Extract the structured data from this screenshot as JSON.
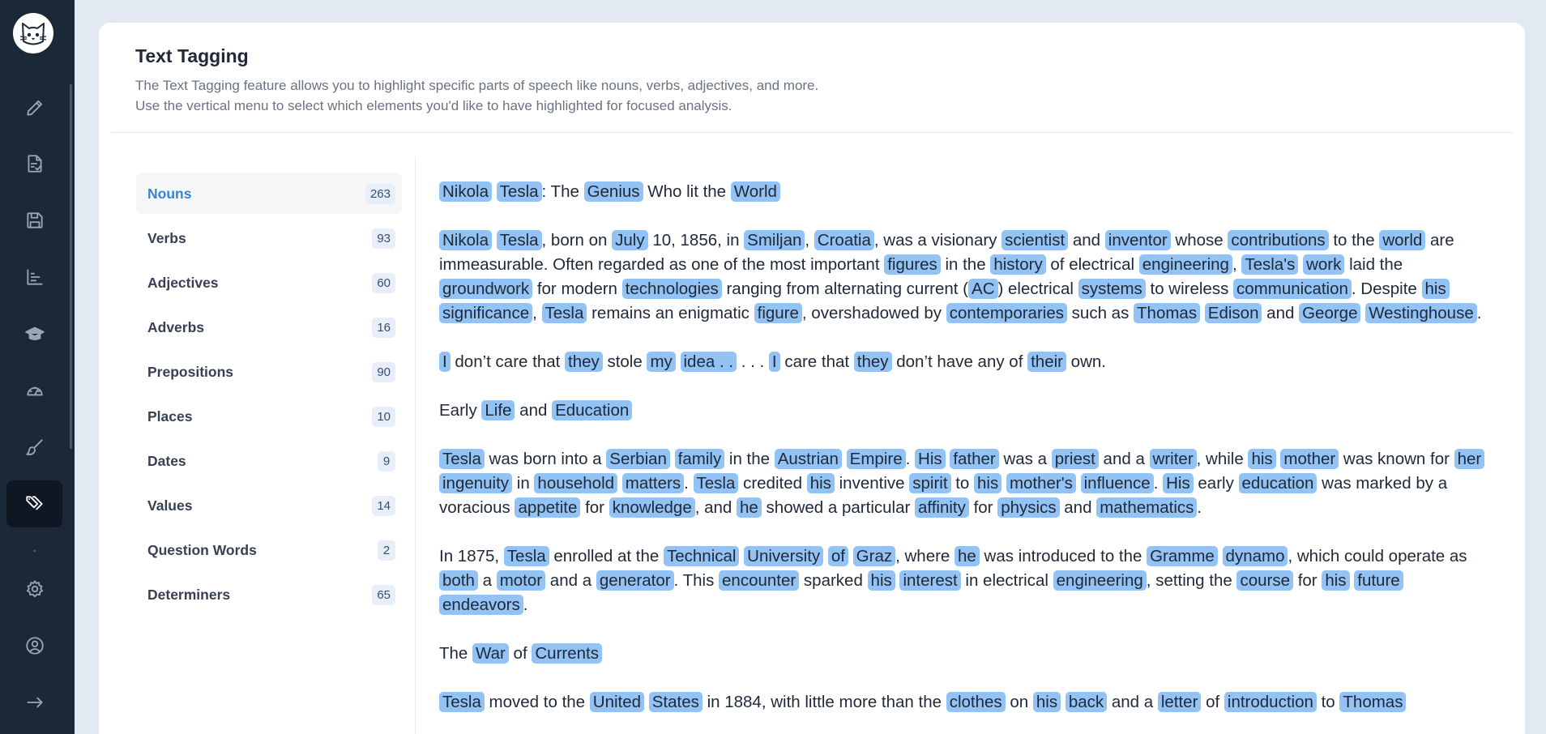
{
  "sidebar": {
    "items": [
      {
        "icon": "pencil-icon",
        "active": false
      },
      {
        "icon": "checklist-icon",
        "active": false
      },
      {
        "icon": "save-icon",
        "active": false
      },
      {
        "icon": "bar-chart-icon",
        "active": false
      },
      {
        "icon": "graduation-cap-icon",
        "active": false
      },
      {
        "icon": "gauge-icon",
        "active": false
      },
      {
        "icon": "brush-icon",
        "active": false
      },
      {
        "icon": "tags-icon",
        "active": true
      },
      {
        "icon": "gear-icon",
        "active": false
      },
      {
        "icon": "user-circle-icon",
        "active": false
      },
      {
        "icon": "arrow-right-icon",
        "active": false
      }
    ]
  },
  "header": {
    "title": "Text Tagging",
    "desc_line1": "The Text Tagging feature allows you to highlight specific parts of speech like nouns, verbs, adjectives, and more.",
    "desc_line2": "Use the vertical menu to select which elements you'd like to have highlighted for focused analysis."
  },
  "menu": [
    {
      "label": "Nouns",
      "count": "263",
      "active": true
    },
    {
      "label": "Verbs",
      "count": "93",
      "active": false
    },
    {
      "label": "Adjectives",
      "count": "60",
      "active": false
    },
    {
      "label": "Adverbs",
      "count": "16",
      "active": false
    },
    {
      "label": "Prepositions",
      "count": "90",
      "active": false
    },
    {
      "label": "Places",
      "count": "10",
      "active": false
    },
    {
      "label": "Dates",
      "count": "9",
      "active": false
    },
    {
      "label": "Values",
      "count": "14",
      "active": false
    },
    {
      "label": "Question Words",
      "count": "2",
      "active": false
    },
    {
      "label": "Determiners",
      "count": "65",
      "active": false
    }
  ],
  "colors": {
    "highlight": "#93c2f5",
    "active_menu": "#3b82d6",
    "sidebar_bg": "#1b2838"
  },
  "paragraphs": [
    [
      [
        "Nikola",
        true
      ],
      [
        " ",
        false
      ],
      [
        "Tesla",
        true
      ],
      [
        ": The ",
        false
      ],
      [
        "Genius",
        true
      ],
      [
        " Who lit the ",
        false
      ],
      [
        "World",
        true
      ]
    ],
    [
      [
        "Nikola",
        true
      ],
      [
        " ",
        false
      ],
      [
        "Tesla",
        true
      ],
      [
        ", born on ",
        false
      ],
      [
        "July",
        true
      ],
      [
        " 10, 1856, in ",
        false
      ],
      [
        "Smiljan",
        true
      ],
      [
        ", ",
        false
      ],
      [
        "Croatia",
        true
      ],
      [
        ", was a visionary ",
        false
      ],
      [
        "scientist",
        true
      ],
      [
        " and ",
        false
      ],
      [
        "inventor",
        true
      ],
      [
        " whose ",
        false
      ],
      [
        "contributions",
        true
      ],
      [
        " to the ",
        false
      ],
      [
        "world",
        true
      ],
      [
        " are immeasurable. Often regarded as one of the most important ",
        false
      ],
      [
        "figures",
        true
      ],
      [
        " in the ",
        false
      ],
      [
        "history",
        true
      ],
      [
        " of electrical ",
        false
      ],
      [
        "engineering",
        true
      ],
      [
        ", ",
        false
      ],
      [
        "Tesla's",
        true
      ],
      [
        " ",
        false
      ],
      [
        "work",
        true
      ],
      [
        " laid the ",
        false
      ],
      [
        "groundwork",
        true
      ],
      [
        " for modern ",
        false
      ],
      [
        "technologies",
        true
      ],
      [
        " ranging from alternating current (",
        false
      ],
      [
        "AC",
        true
      ],
      [
        ") electrical ",
        false
      ],
      [
        "systems",
        true
      ],
      [
        " to wireless ",
        false
      ],
      [
        "communication",
        true
      ],
      [
        ". Despite ",
        false
      ],
      [
        "his",
        true
      ],
      [
        " ",
        false
      ],
      [
        "significance",
        true
      ],
      [
        ", ",
        false
      ],
      [
        "Tesla",
        true
      ],
      [
        " remains an enigmatic ",
        false
      ],
      [
        "figure",
        true
      ],
      [
        ", overshadowed by ",
        false
      ],
      [
        "contemporaries",
        true
      ],
      [
        " such as ",
        false
      ],
      [
        "Thomas",
        true
      ],
      [
        " ",
        false
      ],
      [
        "Edison",
        true
      ],
      [
        " and ",
        false
      ],
      [
        "George",
        true
      ],
      [
        " ",
        false
      ],
      [
        "Westinghouse",
        true
      ],
      [
        ".",
        false
      ]
    ],
    [
      [
        "I",
        true
      ],
      [
        " don’t care that ",
        false
      ],
      [
        "they",
        true
      ],
      [
        " stole ",
        false
      ],
      [
        "my",
        true
      ],
      [
        " ",
        false
      ],
      [
        "idea . .",
        true
      ],
      [
        " . . . ",
        false
      ],
      [
        "I",
        true
      ],
      [
        " care that ",
        false
      ],
      [
        "they",
        true
      ],
      [
        " don’t have any of ",
        false
      ],
      [
        "their",
        true
      ],
      [
        " own.",
        false
      ]
    ],
    [
      [
        "Early ",
        false
      ],
      [
        "Life",
        true
      ],
      [
        " and ",
        false
      ],
      [
        "Education",
        true
      ]
    ],
    [
      [
        "Tesla",
        true
      ],
      [
        " was born into a ",
        false
      ],
      [
        "Serbian",
        true
      ],
      [
        " ",
        false
      ],
      [
        "family",
        true
      ],
      [
        " in the ",
        false
      ],
      [
        "Austrian",
        true
      ],
      [
        " ",
        false
      ],
      [
        "Empire",
        true
      ],
      [
        ". ",
        false
      ],
      [
        "His",
        true
      ],
      [
        " ",
        false
      ],
      [
        "father",
        true
      ],
      [
        " was a ",
        false
      ],
      [
        "priest",
        true
      ],
      [
        " and a ",
        false
      ],
      [
        "writer",
        true
      ],
      [
        ", while ",
        false
      ],
      [
        "his",
        true
      ],
      [
        " ",
        false
      ],
      [
        "mother",
        true
      ],
      [
        " was known for ",
        false
      ],
      [
        "her",
        true
      ],
      [
        " ",
        false
      ],
      [
        "ingenuity",
        true
      ],
      [
        " in ",
        false
      ],
      [
        "household",
        true
      ],
      [
        " ",
        false
      ],
      [
        "matters",
        true
      ],
      [
        ". ",
        false
      ],
      [
        "Tesla",
        true
      ],
      [
        " credited ",
        false
      ],
      [
        "his",
        true
      ],
      [
        " inventive ",
        false
      ],
      [
        "spirit",
        true
      ],
      [
        " to ",
        false
      ],
      [
        "his",
        true
      ],
      [
        " ",
        false
      ],
      [
        "mother's",
        true
      ],
      [
        " ",
        false
      ],
      [
        "influence",
        true
      ],
      [
        ". ",
        false
      ],
      [
        "His",
        true
      ],
      [
        " early ",
        false
      ],
      [
        "education",
        true
      ],
      [
        " was marked by a voracious ",
        false
      ],
      [
        "appetite",
        true
      ],
      [
        " for ",
        false
      ],
      [
        "knowledge",
        true
      ],
      [
        ", and ",
        false
      ],
      [
        "he",
        true
      ],
      [
        " showed a particular ",
        false
      ],
      [
        "affinity",
        true
      ],
      [
        " for ",
        false
      ],
      [
        "physics",
        true
      ],
      [
        " and ",
        false
      ],
      [
        "mathematics",
        true
      ],
      [
        ".",
        false
      ]
    ],
    [
      [
        "In 1875, ",
        false
      ],
      [
        "Tesla",
        true
      ],
      [
        " enrolled at the ",
        false
      ],
      [
        "Technical",
        true
      ],
      [
        " ",
        false
      ],
      [
        "University",
        true
      ],
      [
        " ",
        false
      ],
      [
        "of",
        true
      ],
      [
        " ",
        false
      ],
      [
        "Graz",
        true
      ],
      [
        ", where ",
        false
      ],
      [
        "he",
        true
      ],
      [
        " was introduced to the ",
        false
      ],
      [
        "Gramme",
        true
      ],
      [
        " ",
        false
      ],
      [
        "dynamo",
        true
      ],
      [
        ", which could operate as ",
        false
      ],
      [
        "both",
        true
      ],
      [
        " a ",
        false
      ],
      [
        "motor",
        true
      ],
      [
        " and a ",
        false
      ],
      [
        "generator",
        true
      ],
      [
        ". This ",
        false
      ],
      [
        "encounter",
        true
      ],
      [
        " sparked ",
        false
      ],
      [
        "his",
        true
      ],
      [
        " ",
        false
      ],
      [
        "interest",
        true
      ],
      [
        " in electrical ",
        false
      ],
      [
        "engineering",
        true
      ],
      [
        ", setting the ",
        false
      ],
      [
        "course",
        true
      ],
      [
        " for ",
        false
      ],
      [
        "his",
        true
      ],
      [
        " ",
        false
      ],
      [
        "future",
        true
      ],
      [
        " ",
        false
      ],
      [
        "endeavors",
        true
      ],
      [
        ".",
        false
      ]
    ],
    [
      [
        "The ",
        false
      ],
      [
        "War",
        true
      ],
      [
        " of ",
        false
      ],
      [
        "Currents",
        true
      ]
    ],
    [
      [
        "Tesla",
        true
      ],
      [
        " moved to the ",
        false
      ],
      [
        "United",
        true
      ],
      [
        " ",
        false
      ],
      [
        "States",
        true
      ],
      [
        " in 1884, with little more than the ",
        false
      ],
      [
        "clothes",
        true
      ],
      [
        " on ",
        false
      ],
      [
        "his",
        true
      ],
      [
        " ",
        false
      ],
      [
        "back",
        true
      ],
      [
        " and a ",
        false
      ],
      [
        "letter",
        true
      ],
      [
        " of ",
        false
      ],
      [
        "introduction",
        true
      ],
      [
        " to ",
        false
      ],
      [
        "Thomas",
        true
      ]
    ]
  ]
}
